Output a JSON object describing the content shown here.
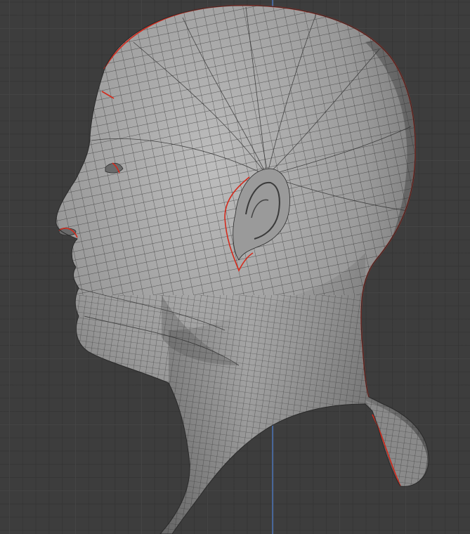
{
  "viewport": {
    "background_color": "#3d3d3d",
    "grid_color": "#484848",
    "axis_color": "#4a6da8"
  },
  "mesh": {
    "object": "head-mesh",
    "shading": "solid-grey",
    "wireframe_overlay": true,
    "edge_color": "#2a2a2a",
    "seam_color": "#d42a1c",
    "surface_light": "#b4b4b4",
    "surface_dark": "#5a5a5a"
  }
}
